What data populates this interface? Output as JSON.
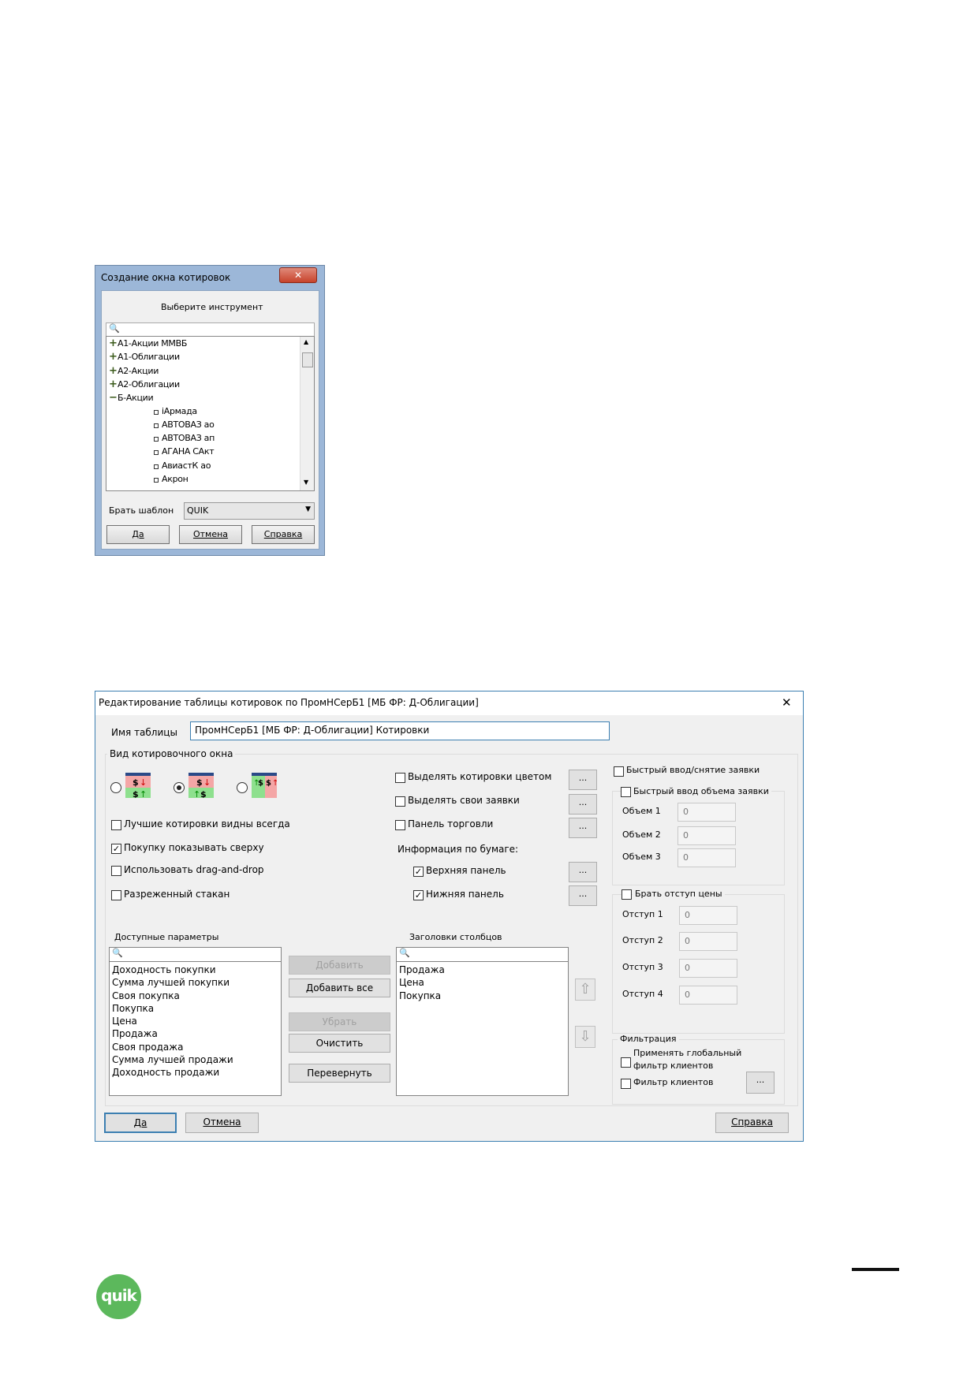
{
  "dialog1": {
    "title": "Создание окна котировок",
    "prompt": "Выберите инструмент",
    "tree": [
      {
        "label": "A1-Акции ММВБ",
        "type": "collapsed"
      },
      {
        "label": "A1-Облигации",
        "type": "collapsed"
      },
      {
        "label": "A2-Акции",
        "type": "collapsed"
      },
      {
        "label": "A2-Облигации",
        "type": "collapsed"
      },
      {
        "label": "Б-Акции",
        "type": "expanded"
      },
      {
        "label": "iАрмада",
        "type": "leaf"
      },
      {
        "label": "АВТОВАЗ ао",
        "type": "leaf"
      },
      {
        "label": "АВТОВАЗ ап",
        "type": "leaf"
      },
      {
        "label": "АГАНА САкт",
        "type": "leaf"
      },
      {
        "label": "АвиастК ао",
        "type": "leaf"
      },
      {
        "label": "Акрон",
        "type": "leaf"
      }
    ],
    "template_label": "Брать шаблон",
    "template_value": "QUIK",
    "ok": "Да",
    "cancel": "Отмена",
    "help": "Справка"
  },
  "dialog2": {
    "title": "Редактирование таблицы котировок по ПромНСерБ1 [МБ ФР: Д-Облигации]",
    "table_name_label": "Имя таблицы",
    "table_name_value": "ПромНСерБ1 [МБ ФР: Д-Облигации] Котировки",
    "view_group": "Вид котировочного окна",
    "best_quotes": "Лучшие котировки видны всегда",
    "buy_on_top": "Покупку показывать сверху",
    "drag_drop": "Использовать drag-and-drop",
    "sparse": "Разреженный стакан",
    "highlight_quotes": "Выделять котировки цветом",
    "highlight_orders": "Выделять свои заявки",
    "trade_panel": "Панель торговли",
    "info_label": "Информация по бумаге:",
    "top_panel": "Верхняя панель",
    "bottom_panel": "Нижняя панель",
    "dots": "...",
    "quick_input": "Быстрый ввод/снятие заявки",
    "quick_volume": "Быстрый ввод объема заявки",
    "volumes": [
      {
        "label": "Объем 1",
        "value": "0"
      },
      {
        "label": "Объем 2",
        "value": "0"
      },
      {
        "label": "Объем 3",
        "value": "0"
      }
    ],
    "price_offset": "Брать отступ цены",
    "offsets": [
      {
        "label": "Отступ 1",
        "value": "0"
      },
      {
        "label": "Отступ 2",
        "value": "0"
      },
      {
        "label": "Отступ 3",
        "value": "0"
      },
      {
        "label": "Отступ 4",
        "value": "0"
      }
    ],
    "filter_group": "Фильтрация",
    "global_filter_line1": "Применять глобальный",
    "global_filter_line2": "фильтр клиентов",
    "client_filter": "Фильтр клиентов",
    "available_label": "Доступные параметры",
    "available": [
      "Доходность покупки",
      "Сумма лучшей покупки",
      "Своя покупка",
      "Покупка",
      "Цена",
      "Продажа",
      "Своя продажа",
      "Сумма лучшей продажи",
      "Доходность продажи"
    ],
    "columns_label": "Заголовки столбцов",
    "columns": [
      "Продажа",
      "Цена",
      "Покупка"
    ],
    "add": "Добавить",
    "add_all": "Добавить все",
    "remove": "Убрать",
    "clear": "Очистить",
    "flip": "Перевернуть",
    "ok": "Да",
    "cancel": "Отмена",
    "help": "Справка",
    "close_glyph": "✕"
  },
  "colors": {
    "accent": "#3c7fb1",
    "logo": "#5cb85c"
  },
  "logo_text": "quik"
}
